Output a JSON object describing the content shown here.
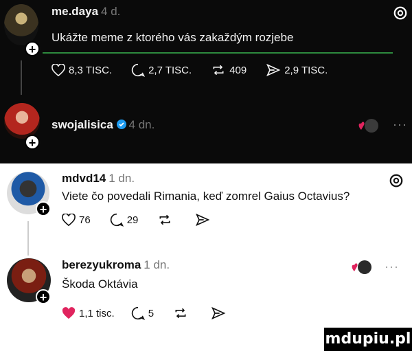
{
  "posts": [
    {
      "username": "me.daya",
      "time": "4 d.",
      "text": "Ukážte meme z ktorého vás zakaždým rozjebe",
      "stats": {
        "likes": "8,3 TISC.",
        "replies": "2,7 TISC.",
        "reposts": "409",
        "shares": "2,9 TISC."
      }
    },
    {
      "username": "swojalisica",
      "time": "4 dn."
    },
    {
      "username": "mdvd14",
      "time": "1 dn.",
      "text": "Viete čo povedali Rimania, keď zomrel Gaius Octavius?",
      "stats": {
        "likes": "76",
        "replies": "29"
      }
    },
    {
      "username": "berezyukroma",
      "time": "1 dn.",
      "text": "Škoda Oktávia",
      "stats": {
        "likes": "1,1 tisc.",
        "replies": "5"
      }
    }
  ],
  "icons": [
    "heart-icon",
    "comment-icon",
    "repost-icon",
    "share-icon",
    "threads-logo-icon",
    "more-icon",
    "verified-icon"
  ],
  "watermark": "mdupiu.pl",
  "colors": {
    "like_red": "#e0245e",
    "verified_blue": "#1d9bf0"
  }
}
